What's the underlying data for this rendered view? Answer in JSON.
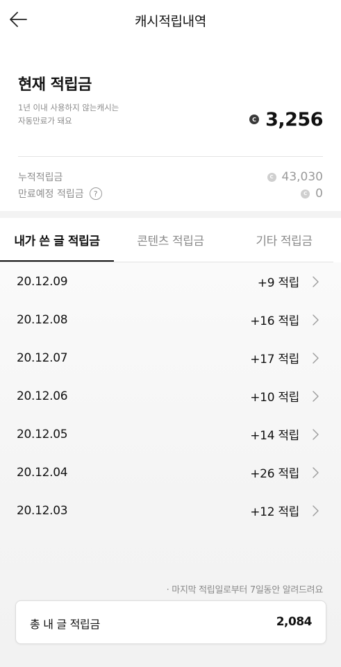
{
  "header": {
    "title": "캐시적립내역",
    "back_icon": "arrow-left-icon"
  },
  "summary": {
    "current_title": "현재 적립금",
    "description_line1": "1년 이내 사용하지 않는캐시는",
    "description_line2": "자동만료가 돼요",
    "coin_icon": "coin-icon",
    "coin_glyph": "C",
    "current_amount": "3,256",
    "accumulated_label": "누적적립금",
    "accumulated_amount": "43,030",
    "expiring_label": "만료예정 적립금",
    "help_glyph": "?",
    "expiring_amount": "0"
  },
  "tabs": [
    {
      "label": "내가 쓴 글 적립금",
      "active": true
    },
    {
      "label": "콘텐츠 적립금",
      "active": false
    },
    {
      "label": "기타 적립금",
      "active": false
    }
  ],
  "rows": [
    {
      "date": "20.12.09",
      "points": "+9 적립"
    },
    {
      "date": "20.12.08",
      "points": "+16 적립"
    },
    {
      "date": "20.12.07",
      "points": "+17 적립"
    },
    {
      "date": "20.12.06",
      "points": "+10 적립"
    },
    {
      "date": "20.12.05",
      "points": "+14 적립"
    },
    {
      "date": "20.12.04",
      "points": "+26 적립"
    },
    {
      "date": "20.12.03",
      "points": "+12 적립"
    }
  ],
  "footnote": "· 마지막 적립일로부터 7일동안 알려드려요",
  "total": {
    "label": "총 내 글 적립금",
    "value": "2,084"
  },
  "colors": {
    "coin_dark": "#3a3a3a",
    "coin_light": "#cfcfcf",
    "active_tab": "#111111",
    "muted_text": "#8a8a8a"
  }
}
